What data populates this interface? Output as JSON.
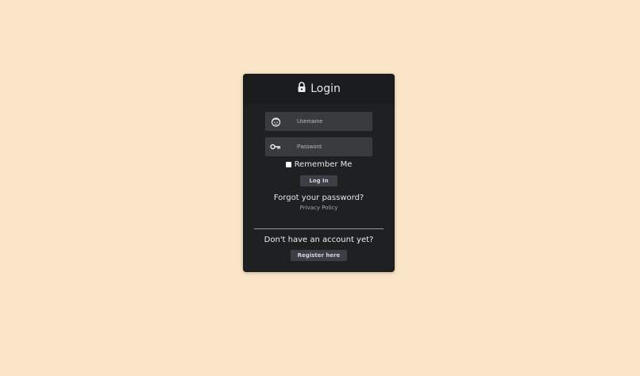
{
  "page": {
    "background": "#fbe5c8",
    "card_background": "#1f2022"
  },
  "login_card": {
    "title": "Login",
    "title_icon": "lock-icon"
  },
  "form": {
    "username": {
      "placeholder": "Username",
      "value": "",
      "icon": "user-face-icon"
    },
    "password": {
      "placeholder": "Password",
      "value": "",
      "icon": "key-icon"
    },
    "remember_label": "Remember Me",
    "remember_checked": false,
    "login_label": "Log In"
  },
  "links": {
    "forgot_password": "Forgot your password?",
    "privacy_policy": "Privacy Policy"
  },
  "register": {
    "prompt": "Don't have an account yet?",
    "button_label": "Register here"
  }
}
